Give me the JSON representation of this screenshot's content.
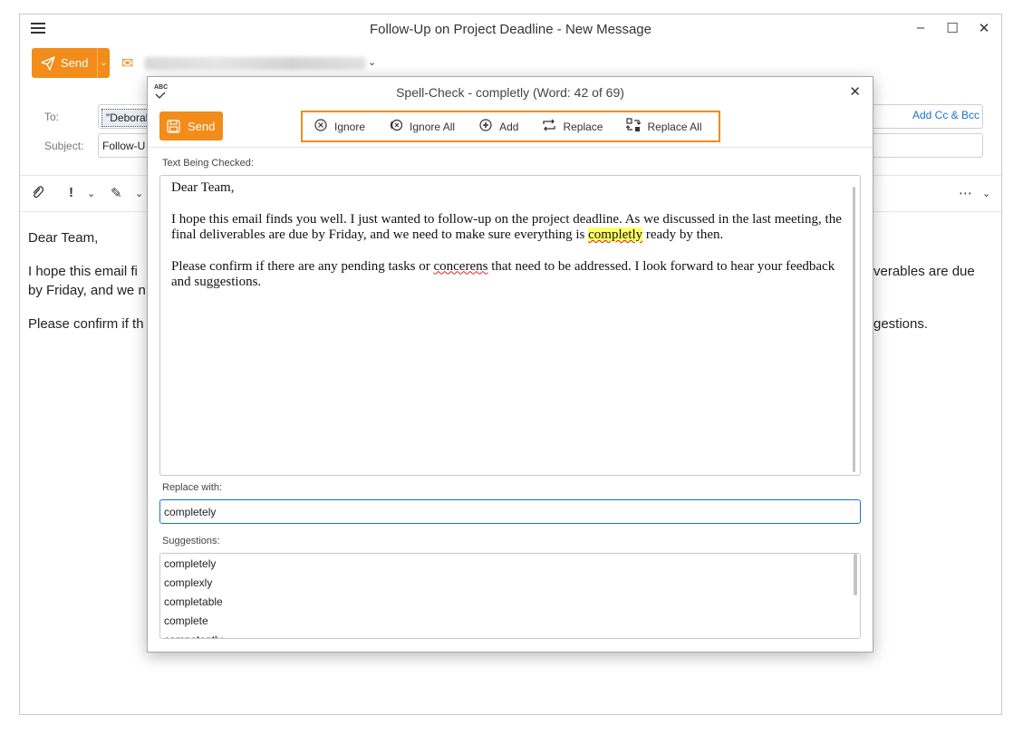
{
  "window": {
    "title": "Follow-Up on Project Deadline - New Message",
    "minimize": "–",
    "maximize": "☐",
    "close": "✕"
  },
  "compose": {
    "send_label": "Send",
    "to_label": "To:",
    "to_value": "\"Deborah",
    "add_cc_bcc": "Add Cc & Bcc",
    "subject_label": "Subject:",
    "subject_value": "Follow-U"
  },
  "body": {
    "greeting": "Dear Team,",
    "line1_left": "I hope this email fi",
    "line1_right": "verables are due",
    "line2_left": "by Friday, and we n",
    "line3_left": "Please confirm if th",
    "line3_right": "gestions."
  },
  "dialog": {
    "title": "Spell-Check - completly (Word: 42 of 69)",
    "abc_icon": "ABC",
    "close": "✕",
    "send_label": "Send",
    "actions": [
      {
        "label": "Ignore",
        "icon": "ignore-icon"
      },
      {
        "label": "Ignore All",
        "icon": "ignore-all-icon"
      },
      {
        "label": "Add",
        "icon": "add-icon"
      },
      {
        "label": "Replace",
        "icon": "replace-icon"
      },
      {
        "label": "Replace All",
        "icon": "replace-all-icon"
      }
    ],
    "text_label": "Text Being Checked:",
    "text": {
      "p1": "Dear Team,",
      "p2_before": "I hope this email finds you well. I just wanted to follow-up on the project deadline. As we discussed in the last meeting, the final deliverables are due by Friday, and we need to make sure everything is ",
      "p2_word": "completly",
      "p2_after": " ready by then.",
      "p3_before": "Please confirm if there are any pending tasks or ",
      "p3_word": "concerens",
      "p3_after": " that need to be addressed. I look forward to hear your feedback and suggestions."
    },
    "replace_label": "Replace with:",
    "replace_value": "completely",
    "suggestions_label": "Suggestions:",
    "suggestions": [
      "completely",
      "complexly",
      "completable",
      "complete",
      "competently"
    ]
  },
  "colors": {
    "accent": "#f28c1a",
    "link": "#1a73c8",
    "highlight": "#ffff66"
  }
}
